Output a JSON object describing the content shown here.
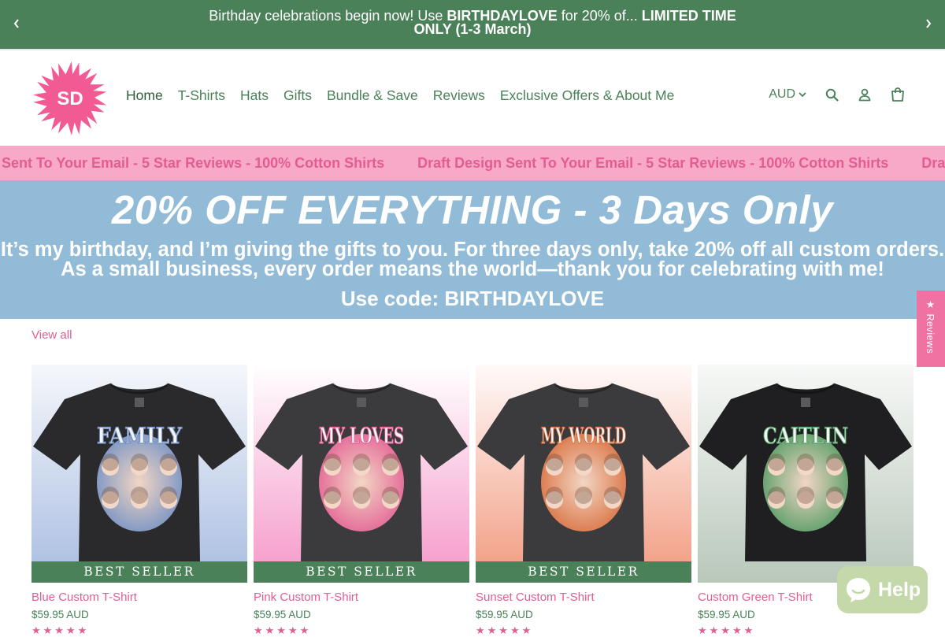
{
  "announcement": {
    "prefix": "Birthday celebrations begin now! Use ",
    "code": "BIRTHDAYLOVE",
    "middle": " for 20% of... ",
    "highlight": "LIMITED TIME ONLY (1-3 March)",
    "prev_icon": "chevron-left-icon",
    "next_icon": "chevron-right-icon"
  },
  "brand": {
    "logo_text": "SD",
    "logo_color": "#f25a94"
  },
  "nav": {
    "items": [
      "Home",
      "T-Shirts",
      "Hats",
      "Gifts",
      "Bundle & Save",
      "Reviews",
      "Exclusive Offers & About Me"
    ]
  },
  "header_utils": {
    "currency": "AUD"
  },
  "marquee": {
    "text": "Draft Design Sent To Your Email - 5 Star Reviews - 100% Cotton Shirts"
  },
  "promo": {
    "headline": "20% OFF EVERYTHING - 3 Days Only",
    "line1": "It’s my birthday, and I’m giving the gifts to you. For three days only, take 20% off all custom orders.",
    "line2": "As a small business, every order means the world—thank you for celebrating with me!",
    "code": "Use code: BIRTHDAYLOVE"
  },
  "collection": {
    "view_all": "View all"
  },
  "products": [
    {
      "title": "Blue Custom T-Shirt",
      "price": "$59.95 AUD",
      "badge": "BEST SELLER",
      "print": "FAMILY",
      "shirt": "#2a2a2c",
      "bg_top": "#f5f7fb",
      "bg_bottom": "#a9bde1",
      "accent": "#6f8fc4"
    },
    {
      "title": "Pink Custom T-Shirt",
      "price": "$59.95 AUD",
      "badge": "BEST SELLER",
      "print": "MY LOVES",
      "shirt": "#3b3b3d",
      "bg_top": "#ffffff",
      "bg_bottom": "#f597c9",
      "accent": "#e35d93"
    },
    {
      "title": "Sunset Custom T-Shirt",
      "price": "$59.95 AUD",
      "badge": "BEST SELLER",
      "print": "MY WORLD",
      "shirt": "#3b3b3d",
      "bg_top": "#fffafa",
      "bg_bottom": "#f19a7e",
      "accent": "#d96d3c"
    },
    {
      "title": "Custom Green T-Shirt",
      "price": "$59.95 AUD",
      "badge": "",
      "print": "CAITLIN",
      "shirt": "#1f1f21",
      "bg_top": "#f7f8f7",
      "bg_bottom": "#b9c8bb",
      "accent": "#4f9a62"
    }
  ],
  "reviews_tab": {
    "label": "★ Reviews"
  },
  "help": {
    "label": "Help"
  },
  "colors": {
    "green": "#4a8158",
    "pink": "#e35d93",
    "marquee_bg": "#f7a9c7",
    "promo_bg": "#92bbd7",
    "help_bg": "#c4d8a9"
  }
}
